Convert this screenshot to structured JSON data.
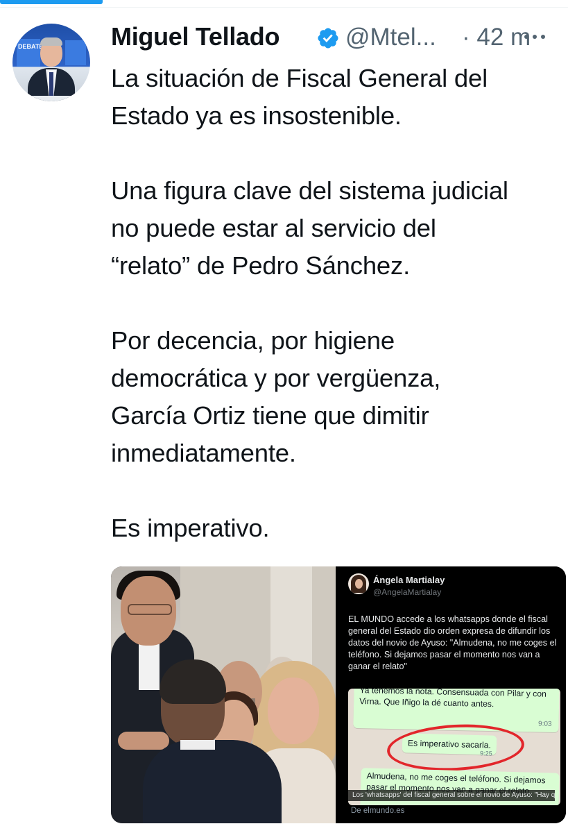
{
  "author": {
    "name": "Miguel Tellado",
    "handle": "@Mtel...",
    "time": "· 42 m",
    "verified": true,
    "avatar_text": "DEBATE"
  },
  "tweet": {
    "text": "La situación de Fiscal General del\nEstado ya es insostenible.\n\nUna figura clave del sistema judicial\nno puede estar al servicio del\n“relato” de Pedro Sánchez.\n\nPor decencia, por higiene\ndemocrática y por vergüenza,\nGarcía Ortiz tiene que dimitir\ninmediatamente.\n\nEs imperativo."
  },
  "embedded_screenshot": {
    "author_name": "Ángela Martialay",
    "author_handle": "@AngelaMartialay",
    "text": "EL MUNDO accede a los whatsapps donde el fiscal general del Estado dio orden expresa de difundir los datos del novio de Ayuso: \"Almudena, no me coges el teléfono. Si dejamos pasar el momento nos van a ganar el relato\"",
    "chat": {
      "message1": "Ya tenemos la nota. Consensuada con Pilar y con Virna. Que Iñigo la dé cuanto antes.",
      "message1_time": "9:03",
      "message2": "Es imperativo sacarla.",
      "message2_time": "9:25",
      "message3": "Almudena, no me coges el teléfono. Si dejamos pasar el momento nos van a ganar el relato."
    },
    "link_caption": "Los 'whatsapps' del fiscal general sobre el novio de Ayuso: \"Hay q...",
    "link_source": "De elmundo.es"
  },
  "colors": {
    "verified_badge": "#1d9bf0",
    "text_primary": "#0f1419",
    "text_secondary": "#536471",
    "highlight_circle": "#e2262b",
    "whatsapp_bubble": "#d9fdd3"
  },
  "icons": [
    "verified-badge-icon",
    "more-options-icon"
  ]
}
